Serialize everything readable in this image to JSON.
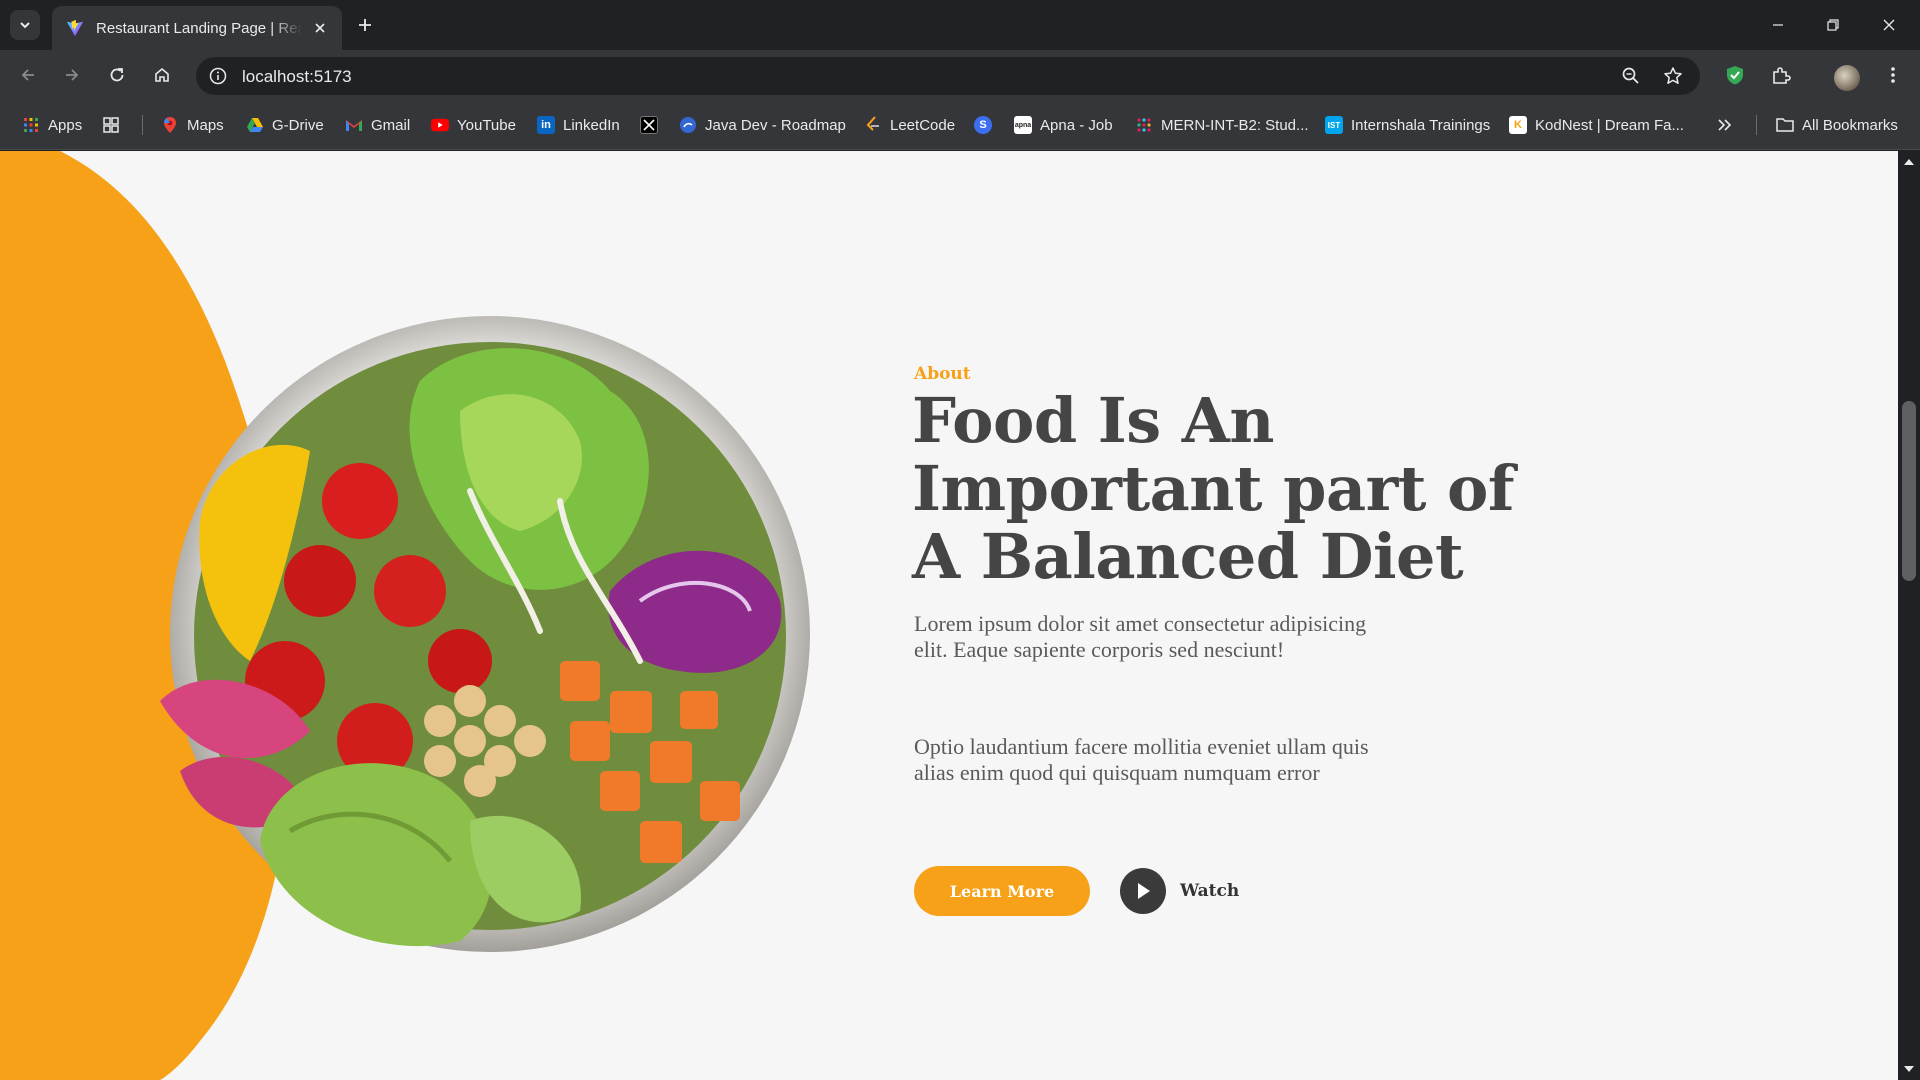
{
  "browser": {
    "tab": {
      "title": "Restaurant Landing Page | React",
      "favicon": "vite-icon"
    },
    "url": "localhost:5173",
    "window_controls": [
      "minimize-icon",
      "restore-icon",
      "close-icon"
    ]
  },
  "bookmarks": [
    {
      "label": "Apps",
      "icon": "apps-grid-icon"
    },
    {
      "label": "",
      "icon": "tab-groups-icon"
    },
    {
      "label": "Maps",
      "icon": "maps-icon"
    },
    {
      "label": "G-Drive",
      "icon": "drive-icon"
    },
    {
      "label": "Gmail",
      "icon": "gmail-icon"
    },
    {
      "label": "YouTube",
      "icon": "youtube-icon"
    },
    {
      "label": "LinkedIn",
      "icon": "linkedin-icon"
    },
    {
      "label": "",
      "icon": "x-icon"
    },
    {
      "label": "Java Dev - Roadmap",
      "icon": "roadmap-icon"
    },
    {
      "label": "LeetCode",
      "icon": "leetcode-icon"
    },
    {
      "label": "",
      "icon": "s-icon"
    },
    {
      "label": "Apna - Job",
      "icon": "apna-icon"
    },
    {
      "label": "MERN-INT-B2: Stud...",
      "icon": "slack-icon"
    },
    {
      "label": "Internshala Trainings",
      "icon": "internshala-icon"
    },
    {
      "label": "KodNest | Dream Fa...",
      "icon": "kodnest-icon"
    },
    {
      "label": "All Bookmarks",
      "icon": "folder-icon"
    }
  ],
  "page": {
    "about_label": "About",
    "headline": "Food Is An Important part of A Balanced Diet",
    "paragraph_1": "Lorem ipsum dolor sit amet consectetur adipisicing elit. Eaque sapiente corporis sed nesciunt!",
    "paragraph_2": "Optio laudantium facere mollitia eveniet ullam quis alias enim quod qui quisquam numquam error",
    "learn_more": "Learn More",
    "watch": "Watch"
  },
  "colors": {
    "accent": "#f6a117",
    "heading": "#454545",
    "background": "#f6f6f6"
  }
}
